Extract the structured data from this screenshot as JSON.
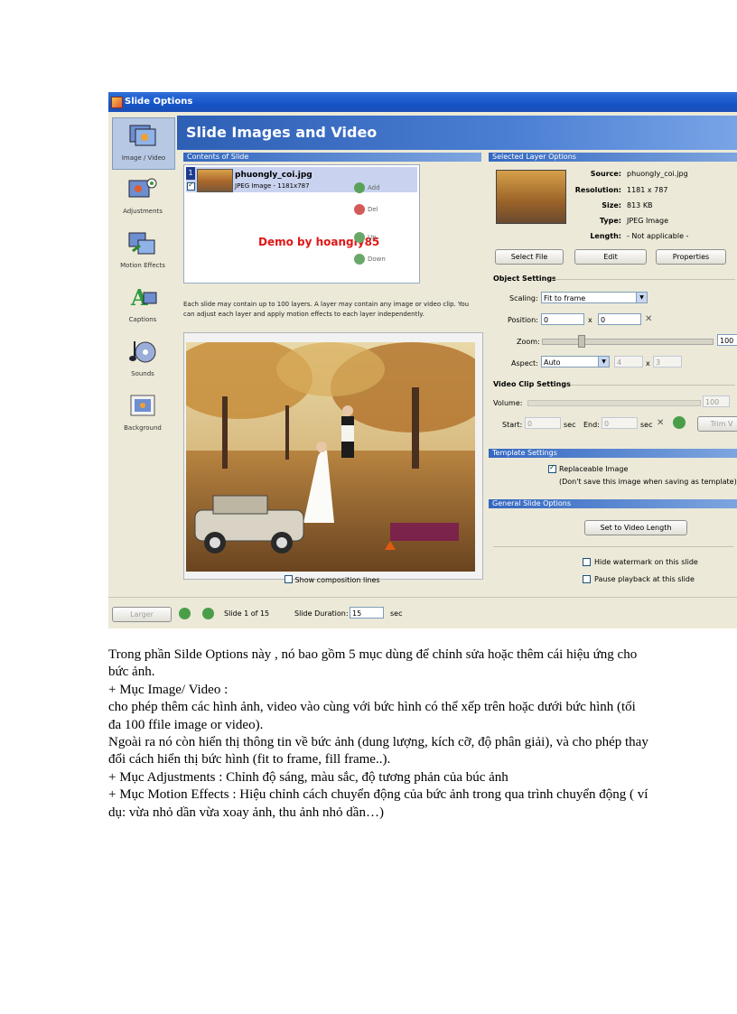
{
  "screenshot": {
    "window_title": "Slide Options",
    "nav": [
      {
        "label": "Image / Video",
        "icon": "image-video-icon"
      },
      {
        "label": "Adjustments",
        "icon": "adjustments-icon"
      },
      {
        "label": "Motion Effects",
        "icon": "motion-effects-icon"
      },
      {
        "label": "Captions",
        "icon": "captions-icon"
      },
      {
        "label": "Sounds",
        "icon": "sounds-icon"
      },
      {
        "label": "Background",
        "icon": "background-icon"
      }
    ],
    "header_title": "Slide Images and Video",
    "contents_header": "Contents of Slide",
    "layer": {
      "number": "1",
      "name": "phuongly_coi.jpg",
      "type": "JPEG Image - 1181x787"
    },
    "watermark_text": "Demo by hoangly85",
    "layer_buttons": {
      "add": "Add",
      "del": "Del",
      "up": "Up",
      "down": "Down"
    },
    "info_text": "Each slide may contain up to 100 layers. A layer may contain any image or video clip. You can adjust each layer and apply motion effects to each layer independently.",
    "show_composition": "Show composition lines",
    "selected_layer_header": "Selected Layer Options",
    "file_info": {
      "source_label": "Source:",
      "source": "phuongly_coi.jpg",
      "resolution_label": "Resolution:",
      "resolution": "1181 x 787",
      "size_label": "Size:",
      "size": "813 KB",
      "type_label": "Type:",
      "type": "JPEG Image",
      "length_label": "Length:",
      "length": "- Not applicable -"
    },
    "buttons": {
      "select_file": "Select File",
      "edit": "Edit",
      "properties": "Properties"
    },
    "object_settings": {
      "title": "Object Settings",
      "scaling_label": "Scaling:",
      "scaling_value": "Fit to frame",
      "position_label": "Position:",
      "pos_x": "0",
      "pos_y": "0",
      "x_sep": "x",
      "zoom_label": "Zoom:",
      "zoom_value": "100",
      "aspect_label": "Aspect:",
      "aspect_value": "Auto",
      "aspect_w": "4",
      "aspect_h": "3"
    },
    "video_clip": {
      "title": "Video Clip Settings",
      "volume_label": "Volume:",
      "volume_value": "100",
      "start_label": "Start:",
      "start_value": "0",
      "sec1": "sec",
      "end_label": "End:",
      "end_value": "0",
      "sec2": "sec",
      "trim_label": "Trim V"
    },
    "template_header": "Template Settings",
    "template": {
      "replaceable": "Replaceable Image",
      "note": "(Don't save this image when saving as template)"
    },
    "general_header": "General Slide Options",
    "general": {
      "set_video": "Set to Video Length",
      "hide_watermark": "Hide watermark on this slide",
      "pause_playback": "Pause playback at this slide"
    },
    "bottom": {
      "larger": "Larger",
      "slide_of": "Slide 1 of 15",
      "duration_label": "Slide Duration:",
      "duration_value": "15",
      "sec": "sec"
    },
    "colors": {
      "header_blue": "#2d5fb5",
      "section_blue": "#3468c0",
      "window_bg": "#ece9d8",
      "demo_red": "#e01616"
    }
  },
  "body_text": [
    "Trong phần Silde Options này , nó bao gồm 5 mục dùng để chỉnh sửa hoặc thêm cái hiệu ứng cho bức ảnh.",
    "+ Mục Image/ Video :",
    "cho phép thêm các hình ảnh, video vào cùng với bức hình có thể xếp trên hoặc dưới bức hình (tối đa 100 ffile image or video).",
    "Ngoài ra nó còn hiển thị thông tin về bức ảnh (dung lượng, kích cỡ, độ phân giải), và cho phép thay đổi cách hiển thị bức hình (fit to frame, fill frame..).",
    "+ Mục Adjustments : Chỉnh độ sáng, màu sắc, độ tương phản của búc ảnh",
    "+ Mục Motion Effects : Hiệu chỉnh cách chuyển động của bức ảnh trong qua trình chuyển động ( ví dụ: vừa nhỏ dần vừa xoay ảnh, thu ảnh nhỏ dần…)"
  ]
}
